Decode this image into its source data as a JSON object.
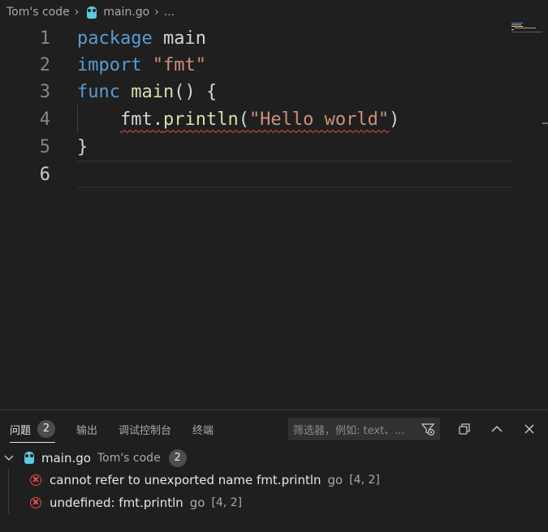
{
  "breadcrumb": {
    "folder": "Tom's code",
    "file": "main.go",
    "more": "..."
  },
  "editor": {
    "lines": [
      {
        "number": "1"
      },
      {
        "number": "2"
      },
      {
        "number": "3"
      },
      {
        "number": "4"
      },
      {
        "number": "5"
      },
      {
        "number": "6"
      }
    ],
    "tokens": {
      "l1_kw": "package",
      "l1_rest": " main",
      "l2_kw": "import",
      "l2_str": "\"fmt\"",
      "l3_kw": "func",
      "l3_fn": "main",
      "l3_rest": "() {",
      "l4_obj": "fmt.",
      "l4_fn": "println",
      "l4_open": "(",
      "l4_str": "\"Hello world\"",
      "l4_close": ")",
      "l5_text": "}"
    }
  },
  "panel": {
    "tabs": [
      {
        "label": "问题",
        "count": "2"
      },
      {
        "label": "输出"
      },
      {
        "label": "调试控制台"
      },
      {
        "label": "终端"
      }
    ],
    "filter_placeholder": "筛选器，例如: text、...",
    "file_group": {
      "file": "main.go",
      "folder": "Tom's code",
      "count": "2"
    },
    "problems": [
      {
        "message": "cannot refer to unexported name fmt.println",
        "source": "go",
        "location": "[4, 2]"
      },
      {
        "message": "undefined: fmt.println",
        "source": "go",
        "location": "[4, 2]"
      }
    ]
  },
  "colors": {
    "background": "#1f1f1f",
    "keyword": "#569cd6",
    "string": "#ce9178",
    "function": "#dcdcaa",
    "error": "#f14c4c"
  }
}
